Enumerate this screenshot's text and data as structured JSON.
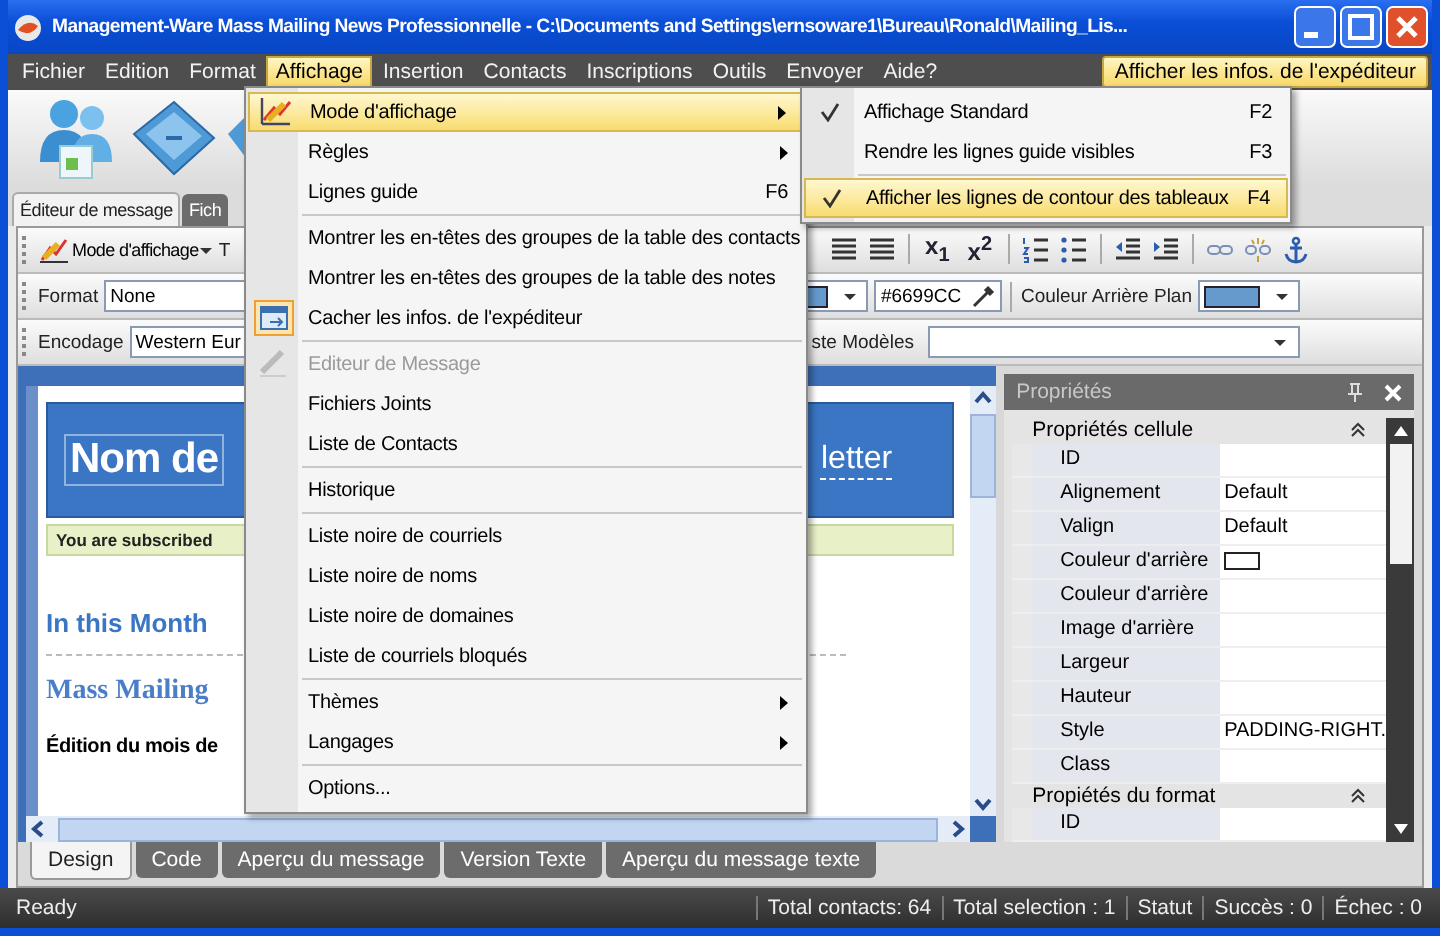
{
  "window": {
    "title": "Management-Ware Mass Mailing News Professionnelle - C:\\Documents and Settings\\ernsoware1\\Bureau\\Ronald\\Mailing_Lis..."
  },
  "menubar": {
    "items": [
      {
        "label": "Fichier",
        "selected": false
      },
      {
        "label": "Edition",
        "selected": false
      },
      {
        "label": "Format",
        "selected": false
      },
      {
        "label": "Affichage",
        "selected": true
      },
      {
        "label": "Insertion",
        "selected": false
      },
      {
        "label": "Contacts",
        "selected": false
      },
      {
        "label": "Inscriptions",
        "selected": false
      },
      {
        "label": "Outils",
        "selected": false
      },
      {
        "label": "Envoyer",
        "selected": false
      },
      {
        "label": "Aide?",
        "selected": false
      }
    ],
    "sender_button": "Afficher les infos. de l'expéditeur"
  },
  "document_tabs": [
    {
      "label": "Éditeur de message",
      "selected": true
    },
    {
      "label": "Fich",
      "selected": false
    }
  ],
  "toolbar": {
    "view_mode_button": "Mode d'affichage",
    "cut_label": "T",
    "script_buttons": [
      "x$_{1}$",
      "x$^{2}$"
    ]
  },
  "format_row": {
    "format_label": "Format",
    "format_value": "None",
    "color_value": "#6699CC",
    "background_label": "Couleur Arrière Plan"
  },
  "encoding_row": {
    "encoding_label": "Encodage",
    "encoding_value": "Western Eur",
    "templates_label": "ste Modèles"
  },
  "editor": {
    "header_title": "Nom de",
    "header_suffix": "letter",
    "subscribed": "You are subscribed",
    "month_heading": "In this Month",
    "brand_heading": "Mass Mailing",
    "edition_heading": "Édition du mois de"
  },
  "properties": {
    "title": "Propriétés",
    "sections": [
      {
        "title": "Propriétés cellule",
        "rows": [
          {
            "name": "ID",
            "kind": "text"
          },
          {
            "name": "Alignement",
            "kind": "text",
            "value": "Default"
          },
          {
            "name": "Valign",
            "kind": "text",
            "value": "Default"
          },
          {
            "name": "Couleur d'arrière",
            "kind": "color"
          },
          {
            "name": "Couleur d'arrière",
            "kind": "text"
          },
          {
            "name": "Image d'arrière",
            "kind": "text"
          },
          {
            "name": "Largeur",
            "kind": "text"
          },
          {
            "name": "Hauteur",
            "kind": "text"
          },
          {
            "name": "Style",
            "kind": "text",
            "value": "PADDING-RIGHT."
          },
          {
            "name": "Class",
            "kind": "text"
          }
        ]
      },
      {
        "title": "Propiétés du format",
        "rows": [
          {
            "name": "ID",
            "kind": "text"
          }
        ]
      }
    ]
  },
  "bottom_tabs": [
    {
      "label": "Design",
      "selected": true
    },
    {
      "label": "Code",
      "selected": false
    },
    {
      "label": "Aperçu du message",
      "selected": false
    },
    {
      "label": "Version Texte",
      "selected": false
    },
    {
      "label": "Aperçu du message texte",
      "selected": false
    }
  ],
  "status_bar": {
    "message": "Ready",
    "panels": [
      "Total contacts: 64",
      "Total selection : 1",
      "Statut",
      "Succès : 0",
      "Échec : 0"
    ]
  },
  "menu": {
    "items": [
      {
        "kind": "item",
        "label": "Mode d'affichage",
        "submenu": true,
        "selected": true,
        "checked": false,
        "disabled": false
      },
      {
        "kind": "item",
        "label": "Règles",
        "submenu": true,
        "selected": false,
        "checked": false,
        "disabled": false
      },
      {
        "kind": "item",
        "label": "Lignes guide",
        "shortcut": "F6",
        "selected": false,
        "checked": false,
        "disabled": false
      },
      {
        "kind": "separator"
      },
      {
        "kind": "item",
        "label": "Montrer les en-têtes des groupes de la table des contacts",
        "selected": false,
        "checked": false,
        "disabled": false
      },
      {
        "kind": "item",
        "label": "Montrer les en-têtes des groupes de la table des notes",
        "selected": false,
        "checked": false,
        "disabled": false
      },
      {
        "kind": "item",
        "label": "Cacher les infos. de l'expéditeur",
        "selected": false,
        "checked": true,
        "disabled": false
      },
      {
        "kind": "separator"
      },
      {
        "kind": "item",
        "label": "Editeur de Message",
        "selected": false,
        "checked": false,
        "disabled": true
      },
      {
        "kind": "item",
        "label": "Fichiers Joints",
        "selected": false,
        "checked": false,
        "disabled": false
      },
      {
        "kind": "item",
        "label": "Liste de Contacts",
        "selected": false,
        "checked": false,
        "disabled": false
      },
      {
        "kind": "separator"
      },
      {
        "kind": "item",
        "label": "Historique",
        "selected": false,
        "checked": false,
        "disabled": false
      },
      {
        "kind": "separator"
      },
      {
        "kind": "item",
        "label": "Liste noire de courriels",
        "selected": false,
        "checked": false,
        "disabled": false
      },
      {
        "kind": "item",
        "label": "Liste noire de noms",
        "selected": false,
        "checked": false,
        "disabled": false
      },
      {
        "kind": "item",
        "label": "Liste noire de domaines",
        "selected": false,
        "checked": false,
        "disabled": false
      },
      {
        "kind": "item",
        "label": "Liste de courriels bloqués",
        "selected": false,
        "checked": false,
        "disabled": false
      },
      {
        "kind": "separator"
      },
      {
        "kind": "item",
        "label": "Thèmes",
        "submenu": true,
        "selected": false,
        "checked": false,
        "disabled": false
      },
      {
        "kind": "item",
        "label": "Langages",
        "submenu": true,
        "selected": false,
        "checked": false,
        "disabled": false
      },
      {
        "kind": "separator"
      },
      {
        "kind": "item",
        "label": "Options...",
        "selected": false,
        "checked": false,
        "disabled": false
      }
    ]
  },
  "submenu": {
    "items": [
      {
        "kind": "item",
        "label": "Affichage Standard",
        "shortcut": "F2",
        "checked": true,
        "selected": false
      },
      {
        "kind": "item",
        "label": "Rendre les lignes guide visibles",
        "shortcut": "F3",
        "checked": false,
        "selected": false
      },
      {
        "kind": "separator"
      },
      {
        "kind": "item",
        "label": "Afficher les lignes de contour des tableaux",
        "shortcut": "F4",
        "checked": true,
        "selected": true
      }
    ]
  }
}
